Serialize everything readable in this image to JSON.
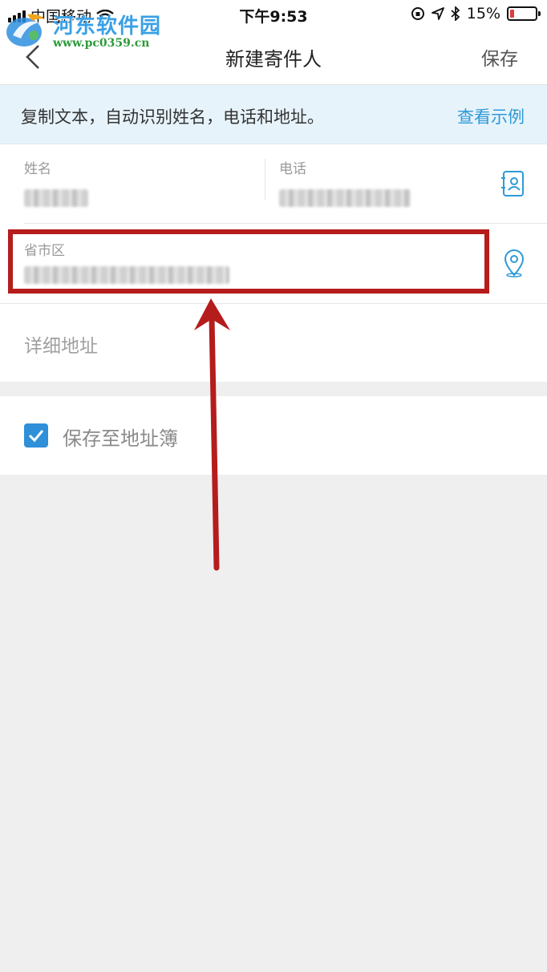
{
  "status_bar": {
    "carrier": "中国移动",
    "time": "下午9:53",
    "battery_percent": "15%",
    "battery_level": 0.15,
    "battery_color": "#e23b3b"
  },
  "watermark": {
    "site_name": "河东软件园",
    "url": "www.pc0359.cn"
  },
  "nav": {
    "title": "新建寄件人",
    "save_label": "保存"
  },
  "hint": {
    "text": "复制文本，自动识别姓名，电话和地址。",
    "link": "查看示例",
    "link_color": "#2d9ad8"
  },
  "form": {
    "name_label": "姓名",
    "phone_label": "电话",
    "region_label": "省市区",
    "detail_placeholder": "详细地址",
    "contacts_icon": "contact-book-icon",
    "location_icon": "location-pin-icon"
  },
  "save_option": {
    "label": "保存至地址簿",
    "checked": true,
    "accent": "#2f8fd8"
  },
  "annotation": {
    "box_color": "#b51c1c",
    "arrow_color": "#b51c1c"
  }
}
